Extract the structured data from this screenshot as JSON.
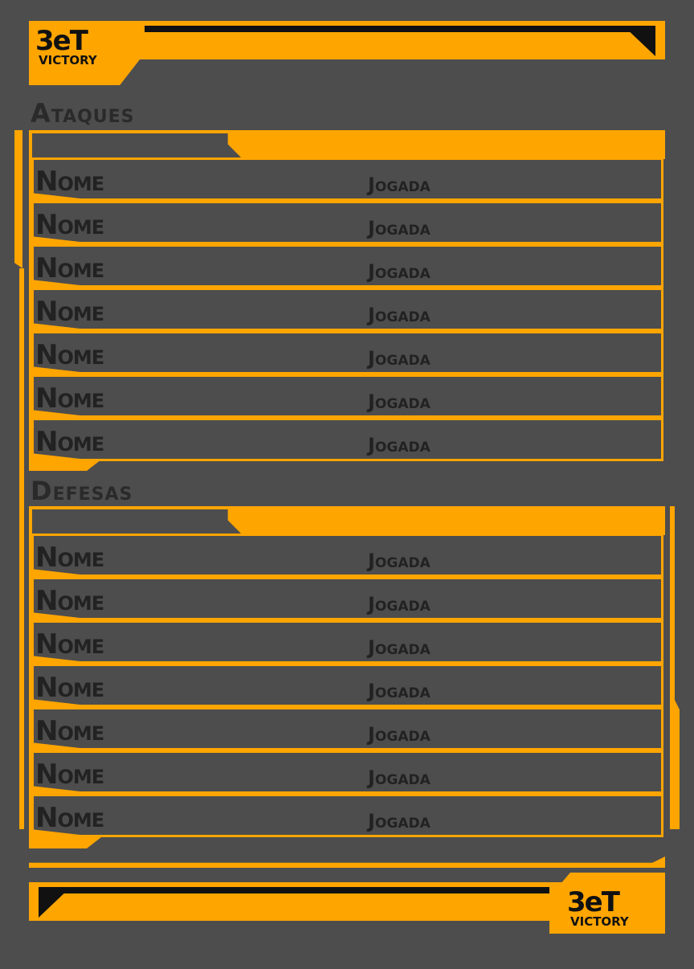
{
  "brand": {
    "mark": "3eT",
    "word": "VICTORY"
  },
  "sections": [
    {
      "title": "Ataques"
    },
    {
      "title": "Defesas"
    }
  ],
  "attacks": [
    {
      "name": "Nome",
      "play": "Jogada"
    },
    {
      "name": "Nome",
      "play": "Jogada"
    },
    {
      "name": "Nome",
      "play": "Jogada"
    },
    {
      "name": "Nome",
      "play": "Jogada"
    },
    {
      "name": "Nome",
      "play": "Jogada"
    },
    {
      "name": "Nome",
      "play": "Jogada"
    },
    {
      "name": "Nome",
      "play": "Jogada"
    }
  ],
  "defenses": [
    {
      "name": "Nome",
      "play": "Jogada"
    },
    {
      "name": "Nome",
      "play": "Jogada"
    },
    {
      "name": "Nome",
      "play": "Jogada"
    },
    {
      "name": "Nome",
      "play": "Jogada"
    },
    {
      "name": "Nome",
      "play": "Jogada"
    },
    {
      "name": "Nome",
      "play": "Jogada"
    },
    {
      "name": "Nome",
      "play": "Jogada"
    }
  ],
  "colors": {
    "accent": "#ffa500",
    "background": "#4d4d4d",
    "ink": "#222222"
  }
}
